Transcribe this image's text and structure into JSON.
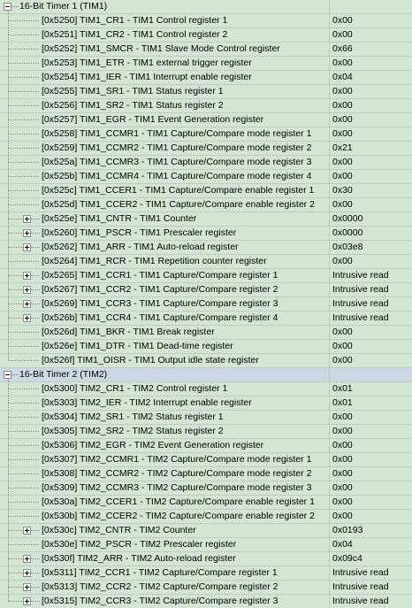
{
  "groups": [
    {
      "label": "16-Bit Timer 1 (TIM1)",
      "expanded": true,
      "selected": false,
      "items": [
        {
          "name": "[0x5250] TIM1_CR1 - TIM1 Control register 1",
          "value": "0x00",
          "expandable": false
        },
        {
          "name": "[0x5251] TIM1_CR2 - TIM1 Control register 2",
          "value": "0x00",
          "expandable": false
        },
        {
          "name": "[0x5252] TIM1_SMCR - TIM1 Slave Mode Control register",
          "value": "0x66",
          "expandable": false
        },
        {
          "name": "[0x5253] TIM1_ETR - TIM1 external trigger register",
          "value": "0x00",
          "expandable": false
        },
        {
          "name": "[0x5254] TIM1_IER - TIM1 Interrupt enable register",
          "value": "0x04",
          "expandable": false
        },
        {
          "name": "[0x5255] TIM1_SR1 - TIM1 Status register 1",
          "value": "0x00",
          "expandable": false
        },
        {
          "name": "[0x5256] TIM1_SR2 - TIM1 Status register 2",
          "value": "0x00",
          "expandable": false
        },
        {
          "name": "[0x5257] TIM1_EGR - TIM1 Event Generation register",
          "value": "0x00",
          "expandable": false
        },
        {
          "name": "[0x5258] TIM1_CCMR1 - TIM1 Capture/Compare mode register 1",
          "value": "0x00",
          "expandable": false
        },
        {
          "name": "[0x5259] TIM1_CCMR2 - TIM1 Capture/Compare mode register 2",
          "value": "0x21",
          "expandable": false
        },
        {
          "name": "[0x525a] TIM1_CCMR3 - TIM1 Capture/Compare mode register 3",
          "value": "0x00",
          "expandable": false
        },
        {
          "name": "[0x525b] TIM1_CCMR4 - TIM1 Capture/Compare mode register 4",
          "value": "0x00",
          "expandable": false
        },
        {
          "name": "[0x525c] TIM1_CCER1 - TIM1 Capture/Compare enable register 1",
          "value": "0x30",
          "expandable": false
        },
        {
          "name": "[0x525d] TIM1_CCER2 - TIM1 Capture/Compare enable register 2",
          "value": "0x00",
          "expandable": false
        },
        {
          "name": "[0x525e] TIM1_CNTR - TIM1 Counter",
          "value": "0x0000",
          "expandable": true
        },
        {
          "name": "[0x5260] TIM1_PSCR - TIM1 Prescaler register",
          "value": "0x0000",
          "expandable": true
        },
        {
          "name": "[0x5262] TIM1_ARR - TIM1 Auto-reload register",
          "value": "0x03e8",
          "expandable": true
        },
        {
          "name": "[0x5264] TIM1_RCR - TIM1 Repetition counter register",
          "value": "0x00",
          "expandable": false
        },
        {
          "name": "[0x5265] TIM1_CCR1 - TIM1 Capture/Compare register 1",
          "value": "Intrusive read",
          "expandable": true
        },
        {
          "name": "[0x5267] TIM1_CCR2 - TIM1 Capture/Compare register 2",
          "value": "Intrusive read",
          "expandable": true
        },
        {
          "name": "[0x5269] TIM1_CCR3 - TIM1 Capture/Compare register 3",
          "value": "Intrusive read",
          "expandable": true
        },
        {
          "name": "[0x526b] TIM1_CCR4 - TIM1 Capture/Compare register 4",
          "value": "Intrusive read",
          "expandable": true
        },
        {
          "name": "[0x526d] TIM1_BKR - TIM1 Break register",
          "value": "0x00",
          "expandable": false
        },
        {
          "name": "[0x526e] TIM1_DTR - TIM1 Dead-time register",
          "value": "0x00",
          "expandable": false
        },
        {
          "name": "[0x526f] TIM1_OISR - TIM1 Output idle state register",
          "value": "0x00",
          "expandable": false
        }
      ]
    },
    {
      "label": "16-Bit Timer 2 (TIM2)",
      "expanded": true,
      "selected": true,
      "items": [
        {
          "name": "[0x5300] TIM2_CR1 - TIM2 Control register 1",
          "value": "0x01",
          "expandable": false
        },
        {
          "name": "[0x5303] TIM2_IER - TIM2 Interrupt enable register",
          "value": "0x01",
          "expandable": false
        },
        {
          "name": "[0x5304] TIM2_SR1 - TIM2 Status register 1",
          "value": "0x00",
          "expandable": false
        },
        {
          "name": "[0x5305] TIM2_SR2 - TIM2 Status register 2",
          "value": "0x00",
          "expandable": false
        },
        {
          "name": "[0x5306] TIM2_EGR - TIM2 Event Generation register",
          "value": "0x00",
          "expandable": false
        },
        {
          "name": "[0x5307] TIM2_CCMR1 - TIM2 Capture/Compare mode register 1",
          "value": "0x00",
          "expandable": false
        },
        {
          "name": "[0x5308] TIM2_CCMR2 - TIM2 Capture/Compare mode register 2",
          "value": "0x00",
          "expandable": false
        },
        {
          "name": "[0x5309] TIM2_CCMR3 - TIM2 Capture/Compare mode register 3",
          "value": "0x00",
          "expandable": false
        },
        {
          "name": "[0x530a] TIM2_CCER1 - TIM2 Capture/Compare enable register 1",
          "value": "0x00",
          "expandable": false
        },
        {
          "name": "[0x530b] TIM2_CCER2 - TIM2 Capture/Compare enable register 2",
          "value": "0x00",
          "expandable": false
        },
        {
          "name": "[0x530c] TIM2_CNTR - TIM2 Counter",
          "value": "0x0193",
          "expandable": true
        },
        {
          "name": "[0x530e] TIM2_PSCR - TIM2 Prescaler register",
          "value": "0x04",
          "expandable": false
        },
        {
          "name": "[0x530f] TIM2_ARR - TIM2 Auto-reload register",
          "value": "0x09c4",
          "expandable": true
        },
        {
          "name": "[0x5311] TIM2_CCR1 - TIM2 Capture/Compare register 1",
          "value": "Intrusive read",
          "expandable": true
        },
        {
          "name": "[0x5313] TIM2_CCR2 - TIM2 Capture/Compare register 2",
          "value": "Intrusive read",
          "expandable": true
        },
        {
          "name": "[0x5315] TIM2_CCR3 - TIM2 Capture/Compare register 3",
          "value": "Intrusive read",
          "expandable": true
        }
      ]
    }
  ]
}
